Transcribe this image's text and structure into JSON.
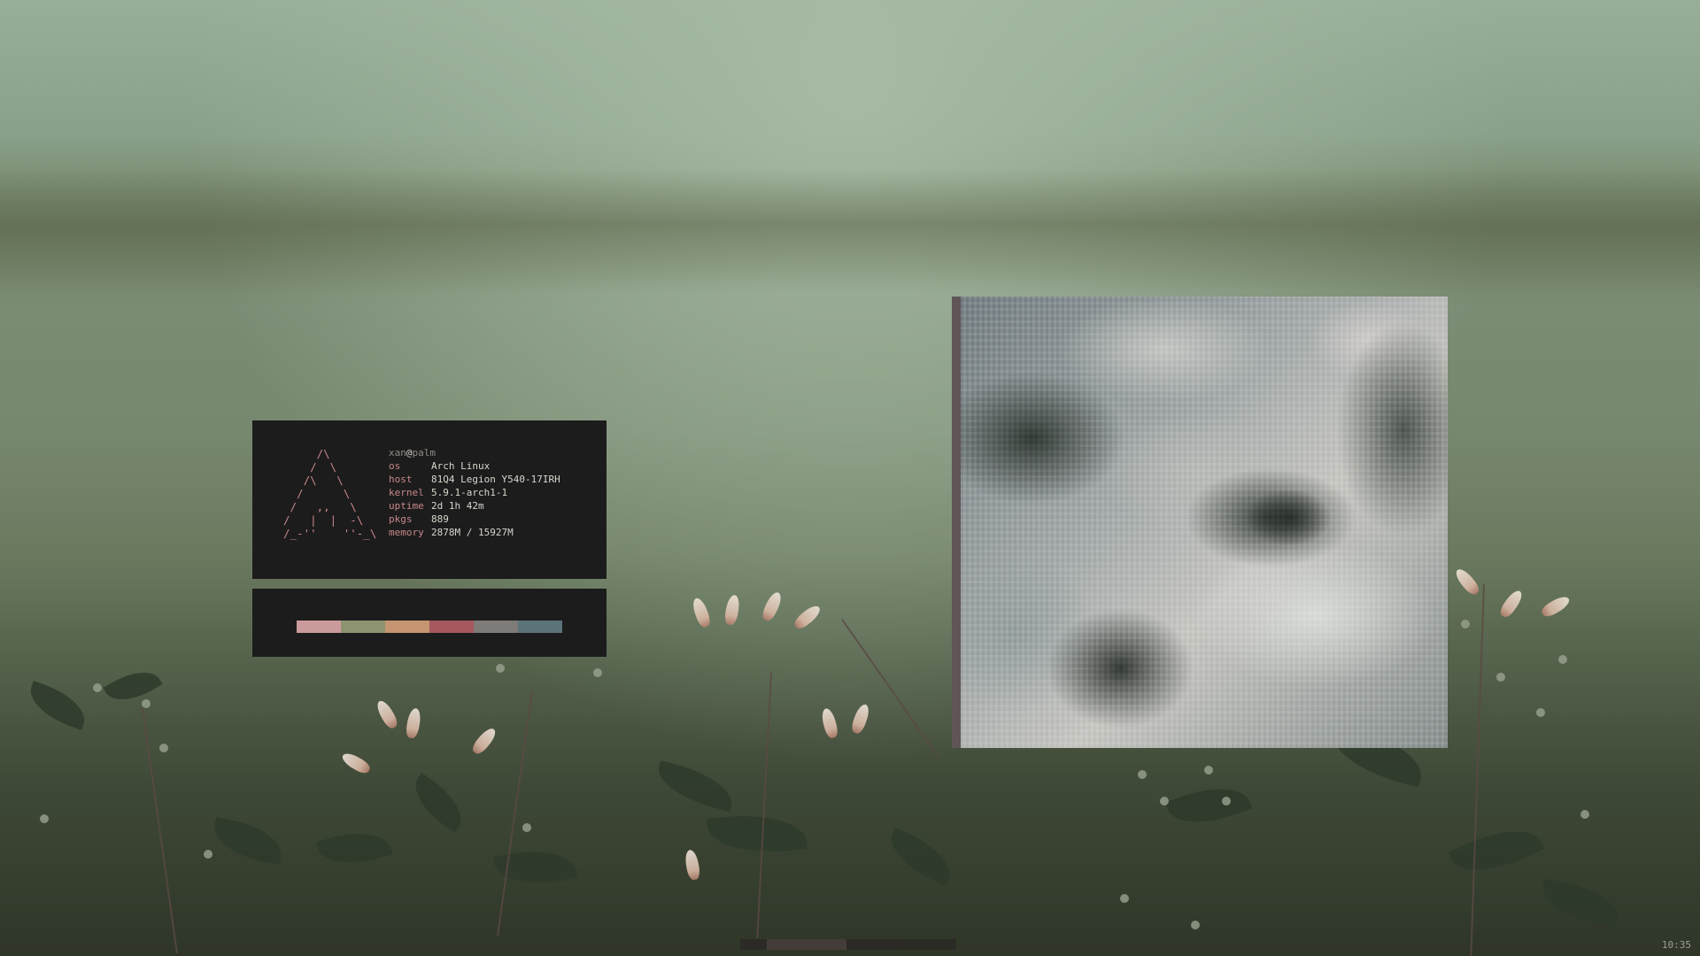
{
  "fetch": {
    "ascii_logo": "     /\\\n    /  \\\n   /\\   \\\n  /      \\\n /   ,,   \\\n/   |  |  -\\\n/_-''    ''-_\\",
    "user": "xan",
    "at": "@",
    "hostname": "palm",
    "rows": [
      {
        "key": "os",
        "value": "Arch Linux"
      },
      {
        "key": "host",
        "value": "81Q4 Legion Y540-17IRH"
      },
      {
        "key": "kernel",
        "value": "5.9.1-arch1-1"
      },
      {
        "key": "uptime",
        "value": "2d 1h 42m"
      },
      {
        "key": "pkgs",
        "value": "889"
      },
      {
        "key": "memory",
        "value": "2878M / 15927M"
      }
    ]
  },
  "palette": {
    "colors": [
      "#cb9a9a",
      "#8e936f",
      "#c49570",
      "#a5585f",
      "#7e7b78",
      "#5b7479"
    ]
  },
  "viewer": {
    "accent_color": "#5f5556"
  },
  "statusbar": {
    "clock": "10:35"
  }
}
